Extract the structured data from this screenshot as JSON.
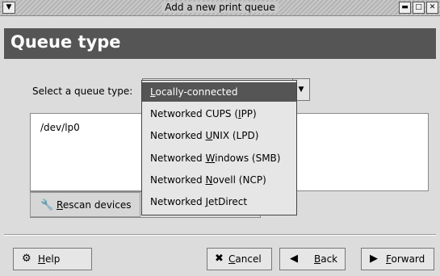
{
  "window": {
    "title": "Add a new print queue"
  },
  "header": {
    "title": "Queue type"
  },
  "select": {
    "label": "Select a queue type:",
    "selected": "Locally-connected",
    "options": [
      {
        "pre": "",
        "u": "L",
        "post": "ocally-connected"
      },
      {
        "pre": "Networked CUPS (",
        "u": "I",
        "post": "PP)"
      },
      {
        "pre": "Networked ",
        "u": "U",
        "post": "NIX (LPD)"
      },
      {
        "pre": "Networked ",
        "u": "W",
        "post": "indows (SMB)"
      },
      {
        "pre": "Networked ",
        "u": "N",
        "post": "ovell (NCP)"
      },
      {
        "pre": "Networked ",
        "u": "J",
        "post": "etDirect"
      }
    ]
  },
  "devices": {
    "items": [
      "/dev/lp0"
    ]
  },
  "rescan": {
    "u": "R",
    "post": "escan devices"
  },
  "buttons": {
    "help": {
      "u": "H",
      "post": "elp"
    },
    "cancel": {
      "u": "C",
      "post": "ancel"
    },
    "back": {
      "u": "B",
      "post": "ack"
    },
    "forward": {
      "u": "F",
      "post": "orward"
    }
  },
  "icons": {
    "window_menu": "chevron-down-icon",
    "minimize": "minimize-icon",
    "maximize": "maximize-icon",
    "close": "close-icon",
    "rescan": "rescan-icon",
    "help": "help-icon",
    "cancel": "cancel-icon",
    "back": "back-arrow-icon",
    "forward": "forward-arrow-icon"
  }
}
